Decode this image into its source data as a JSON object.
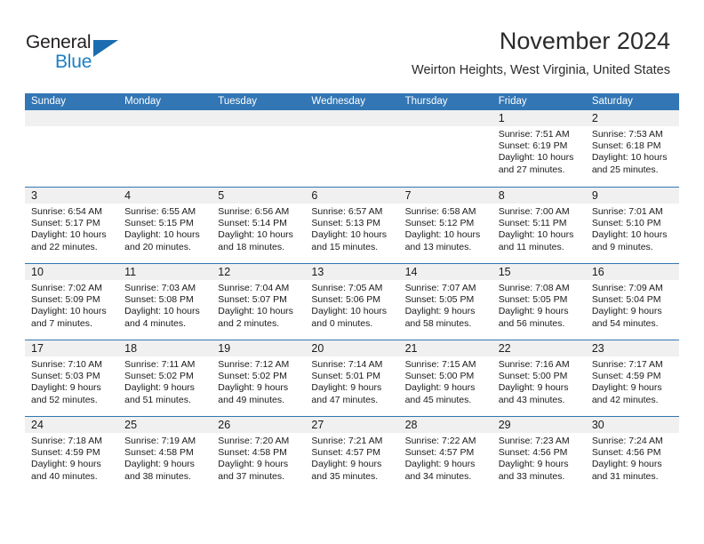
{
  "logo": {
    "word_one": "General",
    "word_two": "Blue",
    "triangle_icon": "triangle-icon",
    "colors": {
      "dark": "#231f20",
      "blue": "#1b7fc4",
      "triangle": "#1b6cb0"
    }
  },
  "header": {
    "title": "November 2024",
    "subtitle": "Weirton Heights, West Virginia, United States"
  },
  "theme": {
    "header_blue": "#3276b5",
    "day_band_gray": "#f0f0f0",
    "text": "#1a1a1a"
  },
  "weekdays": [
    "Sunday",
    "Monday",
    "Tuesday",
    "Wednesday",
    "Thursday",
    "Friday",
    "Saturday"
  ],
  "weeks": [
    [
      {
        "day": "",
        "empty": true
      },
      {
        "day": "",
        "empty": true
      },
      {
        "day": "",
        "empty": true
      },
      {
        "day": "",
        "empty": true
      },
      {
        "day": "",
        "empty": true
      },
      {
        "day": "1",
        "sunrise": "Sunrise: 7:51 AM",
        "sunset": "Sunset: 6:19 PM",
        "daylight_line1": "Daylight: 10 hours",
        "daylight_line2": "and 27 minutes."
      },
      {
        "day": "2",
        "sunrise": "Sunrise: 7:53 AM",
        "sunset": "Sunset: 6:18 PM",
        "daylight_line1": "Daylight: 10 hours",
        "daylight_line2": "and 25 minutes."
      }
    ],
    [
      {
        "day": "3",
        "sunrise": "Sunrise: 6:54 AM",
        "sunset": "Sunset: 5:17 PM",
        "daylight_line1": "Daylight: 10 hours",
        "daylight_line2": "and 22 minutes."
      },
      {
        "day": "4",
        "sunrise": "Sunrise: 6:55 AM",
        "sunset": "Sunset: 5:15 PM",
        "daylight_line1": "Daylight: 10 hours",
        "daylight_line2": "and 20 minutes."
      },
      {
        "day": "5",
        "sunrise": "Sunrise: 6:56 AM",
        "sunset": "Sunset: 5:14 PM",
        "daylight_line1": "Daylight: 10 hours",
        "daylight_line2": "and 18 minutes."
      },
      {
        "day": "6",
        "sunrise": "Sunrise: 6:57 AM",
        "sunset": "Sunset: 5:13 PM",
        "daylight_line1": "Daylight: 10 hours",
        "daylight_line2": "and 15 minutes."
      },
      {
        "day": "7",
        "sunrise": "Sunrise: 6:58 AM",
        "sunset": "Sunset: 5:12 PM",
        "daylight_line1": "Daylight: 10 hours",
        "daylight_line2": "and 13 minutes."
      },
      {
        "day": "8",
        "sunrise": "Sunrise: 7:00 AM",
        "sunset": "Sunset: 5:11 PM",
        "daylight_line1": "Daylight: 10 hours",
        "daylight_line2": "and 11 minutes."
      },
      {
        "day": "9",
        "sunrise": "Sunrise: 7:01 AM",
        "sunset": "Sunset: 5:10 PM",
        "daylight_line1": "Daylight: 10 hours",
        "daylight_line2": "and 9 minutes."
      }
    ],
    [
      {
        "day": "10",
        "sunrise": "Sunrise: 7:02 AM",
        "sunset": "Sunset: 5:09 PM",
        "daylight_line1": "Daylight: 10 hours",
        "daylight_line2": "and 7 minutes."
      },
      {
        "day": "11",
        "sunrise": "Sunrise: 7:03 AM",
        "sunset": "Sunset: 5:08 PM",
        "daylight_line1": "Daylight: 10 hours",
        "daylight_line2": "and 4 minutes."
      },
      {
        "day": "12",
        "sunrise": "Sunrise: 7:04 AM",
        "sunset": "Sunset: 5:07 PM",
        "daylight_line1": "Daylight: 10 hours",
        "daylight_line2": "and 2 minutes."
      },
      {
        "day": "13",
        "sunrise": "Sunrise: 7:05 AM",
        "sunset": "Sunset: 5:06 PM",
        "daylight_line1": "Daylight: 10 hours",
        "daylight_line2": "and 0 minutes."
      },
      {
        "day": "14",
        "sunrise": "Sunrise: 7:07 AM",
        "sunset": "Sunset: 5:05 PM",
        "daylight_line1": "Daylight: 9 hours",
        "daylight_line2": "and 58 minutes."
      },
      {
        "day": "15",
        "sunrise": "Sunrise: 7:08 AM",
        "sunset": "Sunset: 5:05 PM",
        "daylight_line1": "Daylight: 9 hours",
        "daylight_line2": "and 56 minutes."
      },
      {
        "day": "16",
        "sunrise": "Sunrise: 7:09 AM",
        "sunset": "Sunset: 5:04 PM",
        "daylight_line1": "Daylight: 9 hours",
        "daylight_line2": "and 54 minutes."
      }
    ],
    [
      {
        "day": "17",
        "sunrise": "Sunrise: 7:10 AM",
        "sunset": "Sunset: 5:03 PM",
        "daylight_line1": "Daylight: 9 hours",
        "daylight_line2": "and 52 minutes."
      },
      {
        "day": "18",
        "sunrise": "Sunrise: 7:11 AM",
        "sunset": "Sunset: 5:02 PM",
        "daylight_line1": "Daylight: 9 hours",
        "daylight_line2": "and 51 minutes."
      },
      {
        "day": "19",
        "sunrise": "Sunrise: 7:12 AM",
        "sunset": "Sunset: 5:02 PM",
        "daylight_line1": "Daylight: 9 hours",
        "daylight_line2": "and 49 minutes."
      },
      {
        "day": "20",
        "sunrise": "Sunrise: 7:14 AM",
        "sunset": "Sunset: 5:01 PM",
        "daylight_line1": "Daylight: 9 hours",
        "daylight_line2": "and 47 minutes."
      },
      {
        "day": "21",
        "sunrise": "Sunrise: 7:15 AM",
        "sunset": "Sunset: 5:00 PM",
        "daylight_line1": "Daylight: 9 hours",
        "daylight_line2": "and 45 minutes."
      },
      {
        "day": "22",
        "sunrise": "Sunrise: 7:16 AM",
        "sunset": "Sunset: 5:00 PM",
        "daylight_line1": "Daylight: 9 hours",
        "daylight_line2": "and 43 minutes."
      },
      {
        "day": "23",
        "sunrise": "Sunrise: 7:17 AM",
        "sunset": "Sunset: 4:59 PM",
        "daylight_line1": "Daylight: 9 hours",
        "daylight_line2": "and 42 minutes."
      }
    ],
    [
      {
        "day": "24",
        "sunrise": "Sunrise: 7:18 AM",
        "sunset": "Sunset: 4:59 PM",
        "daylight_line1": "Daylight: 9 hours",
        "daylight_line2": "and 40 minutes."
      },
      {
        "day": "25",
        "sunrise": "Sunrise: 7:19 AM",
        "sunset": "Sunset: 4:58 PM",
        "daylight_line1": "Daylight: 9 hours",
        "daylight_line2": "and 38 minutes."
      },
      {
        "day": "26",
        "sunrise": "Sunrise: 7:20 AM",
        "sunset": "Sunset: 4:58 PM",
        "daylight_line1": "Daylight: 9 hours",
        "daylight_line2": "and 37 minutes."
      },
      {
        "day": "27",
        "sunrise": "Sunrise: 7:21 AM",
        "sunset": "Sunset: 4:57 PM",
        "daylight_line1": "Daylight: 9 hours",
        "daylight_line2": "and 35 minutes."
      },
      {
        "day": "28",
        "sunrise": "Sunrise: 7:22 AM",
        "sunset": "Sunset: 4:57 PM",
        "daylight_line1": "Daylight: 9 hours",
        "daylight_line2": "and 34 minutes."
      },
      {
        "day": "29",
        "sunrise": "Sunrise: 7:23 AM",
        "sunset": "Sunset: 4:56 PM",
        "daylight_line1": "Daylight: 9 hours",
        "daylight_line2": "and 33 minutes."
      },
      {
        "day": "30",
        "sunrise": "Sunrise: 7:24 AM",
        "sunset": "Sunset: 4:56 PM",
        "daylight_line1": "Daylight: 9 hours",
        "daylight_line2": "and 31 minutes."
      }
    ]
  ]
}
